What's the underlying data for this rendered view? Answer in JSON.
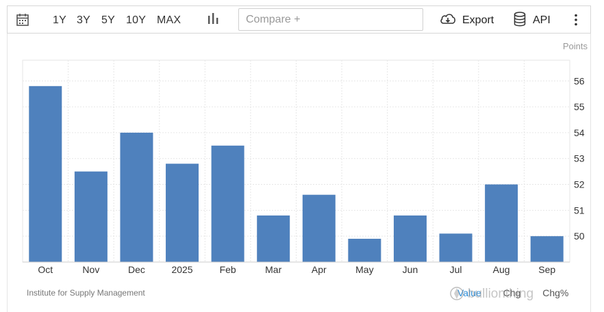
{
  "toolbar": {
    "ranges": [
      "1Y",
      "3Y",
      "5Y",
      "10Y",
      "MAX"
    ],
    "compare_placeholder": "Compare +",
    "export_label": "Export",
    "api_label": "API",
    "icons": [
      "calendar-icon",
      "bar-chart-icon",
      "cloud-download-icon",
      "database-icon",
      "kebab-menu-icon"
    ]
  },
  "units_label": "Points",
  "source": "Institute for Supply Management",
  "footer": {
    "toggles": [
      "Value",
      "Chg",
      "Chg%"
    ]
  },
  "watermark": "bullionthing",
  "colors": {
    "bar": "#4f81bd",
    "grid": "#e6e6e6",
    "axis_text": "#333333"
  },
  "chart_data": {
    "type": "bar",
    "categories": [
      "Oct",
      "Nov",
      "Dec",
      "2025",
      "Feb",
      "Mar",
      "Apr",
      "May",
      "Jun",
      "Jul",
      "Aug",
      "Sep"
    ],
    "values": [
      55.8,
      52.5,
      54.0,
      52.8,
      53.5,
      50.8,
      51.6,
      49.9,
      50.8,
      50.1,
      52.0,
      50.0
    ],
    "title": "",
    "xlabel": "",
    "ylabel": "Points",
    "ylim": [
      49.0,
      56.8
    ],
    "yticks": [
      50,
      51,
      52,
      53,
      54,
      55,
      56
    ],
    "y_axis_position": "right",
    "grid": true
  }
}
